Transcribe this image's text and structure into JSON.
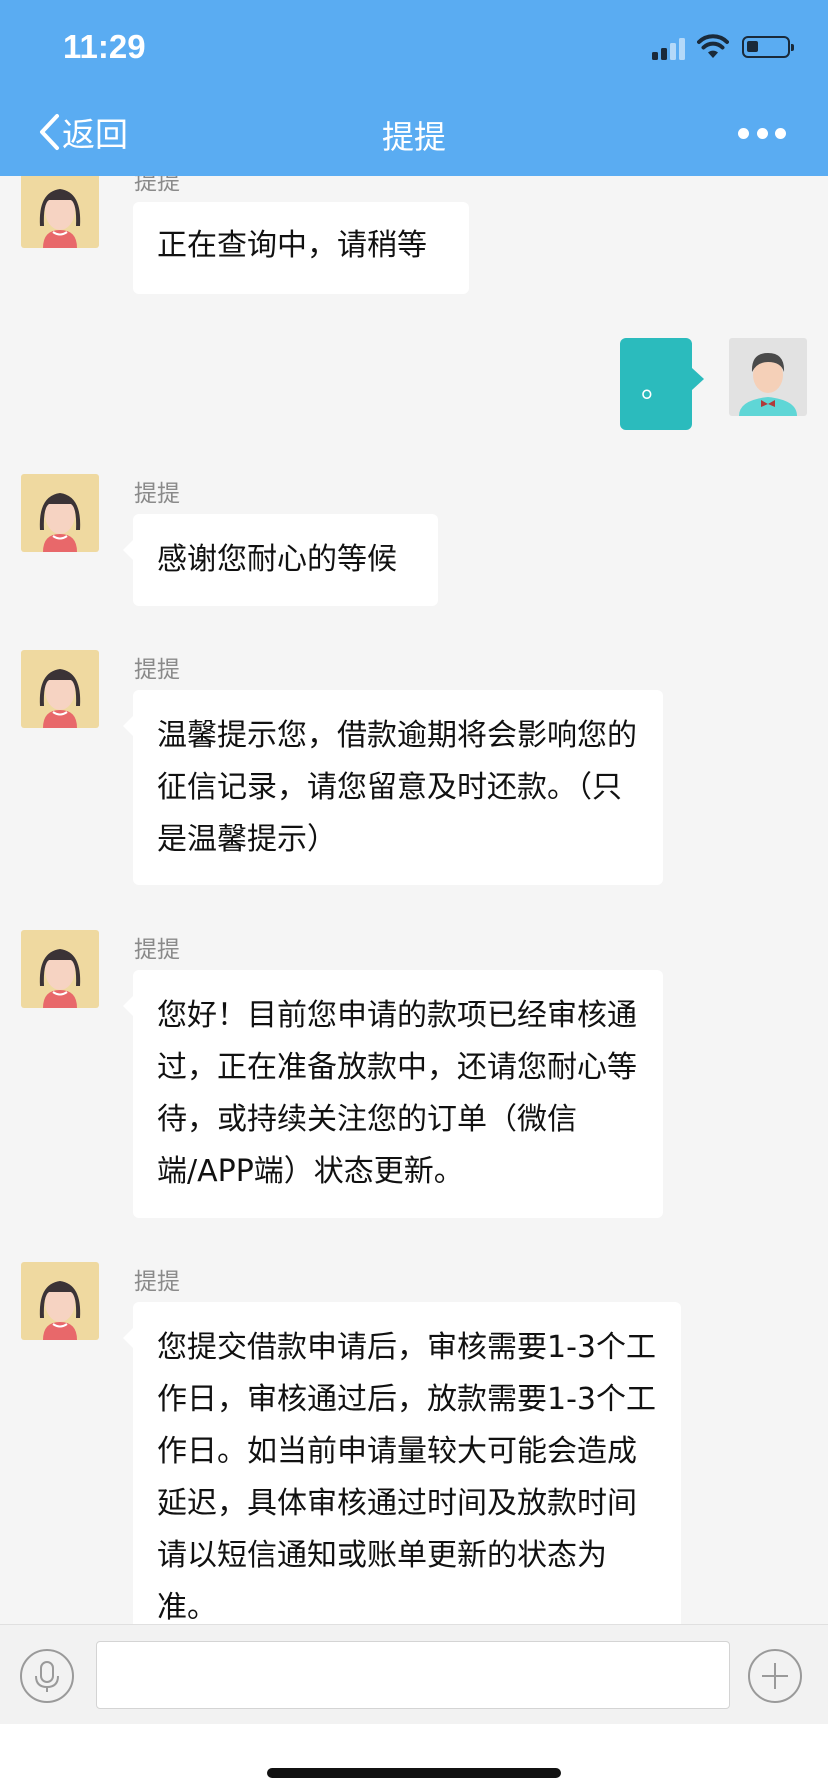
{
  "status_bar": {
    "time": "11:29"
  },
  "header": {
    "back_label": "返回",
    "title": "提提"
  },
  "messages": [
    {
      "sender": "提提",
      "text": "正在查询中，请稍等"
    },
    {
      "sender": "me",
      "text": "。"
    },
    {
      "sender": "提提",
      "text": "感谢您耐心的等候"
    },
    {
      "sender": "提提",
      "text": "温馨提示您，借款逾期将会影响您的征信记录，请您留意及时还款。（只是温馨提示）"
    },
    {
      "sender": "提提",
      "text": "您好！目前您申请的款项已经审核通过，正在准备放款中，还请您耐心等待，或持续关注您的订单（微信端/APP端）状态更新。"
    },
    {
      "sender": "提提",
      "text": "您提交借款申请后，审核需要1-3个工作日，审核通过后，放款需要1-3个工作日。如当前申请量较大可能会造成延迟，具体审核通过时间及放款时间请以短信通知或账单更新的状态为准。"
    }
  ],
  "input": {
    "value": "",
    "placeholder": ""
  },
  "colors": {
    "header": "#5aacf2",
    "my_bubble": "#2bbbbd",
    "background": "#f5f5f5"
  },
  "icons": [
    "back-chevron-icon",
    "more-icon",
    "microphone-icon",
    "plus-icon",
    "wifi-icon",
    "battery-icon",
    "signal-icon"
  ]
}
